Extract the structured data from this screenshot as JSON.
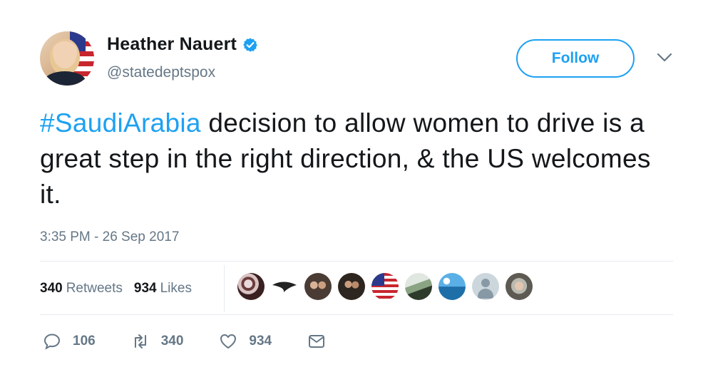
{
  "author": {
    "name": "Heather Nauert",
    "handle": "@statedeptspox",
    "verified": true
  },
  "follow_button": {
    "label": "Follow"
  },
  "tweet": {
    "hashtag": "#SaudiArabia",
    "text": " decision to allow women to drive is a great step in the right direction, & the US welcomes it.",
    "timestamp": "3:35 PM - 26 Sep 2017"
  },
  "stats": {
    "retweets_count": "340",
    "retweets_label": "Retweets",
    "likes_count": "934",
    "likes_label": "Likes"
  },
  "actions": {
    "reply_count": "106",
    "retweet_count": "340",
    "like_count": "934"
  },
  "colors": {
    "accent": "#1da1f2",
    "text": "#14171a",
    "muted": "#657786",
    "divider": "#e6ecf0"
  },
  "icons": [
    "verified-badge-icon",
    "chevron-down-icon",
    "reply-icon",
    "retweet-icon",
    "like-heart-icon",
    "direct-message-icon"
  ]
}
